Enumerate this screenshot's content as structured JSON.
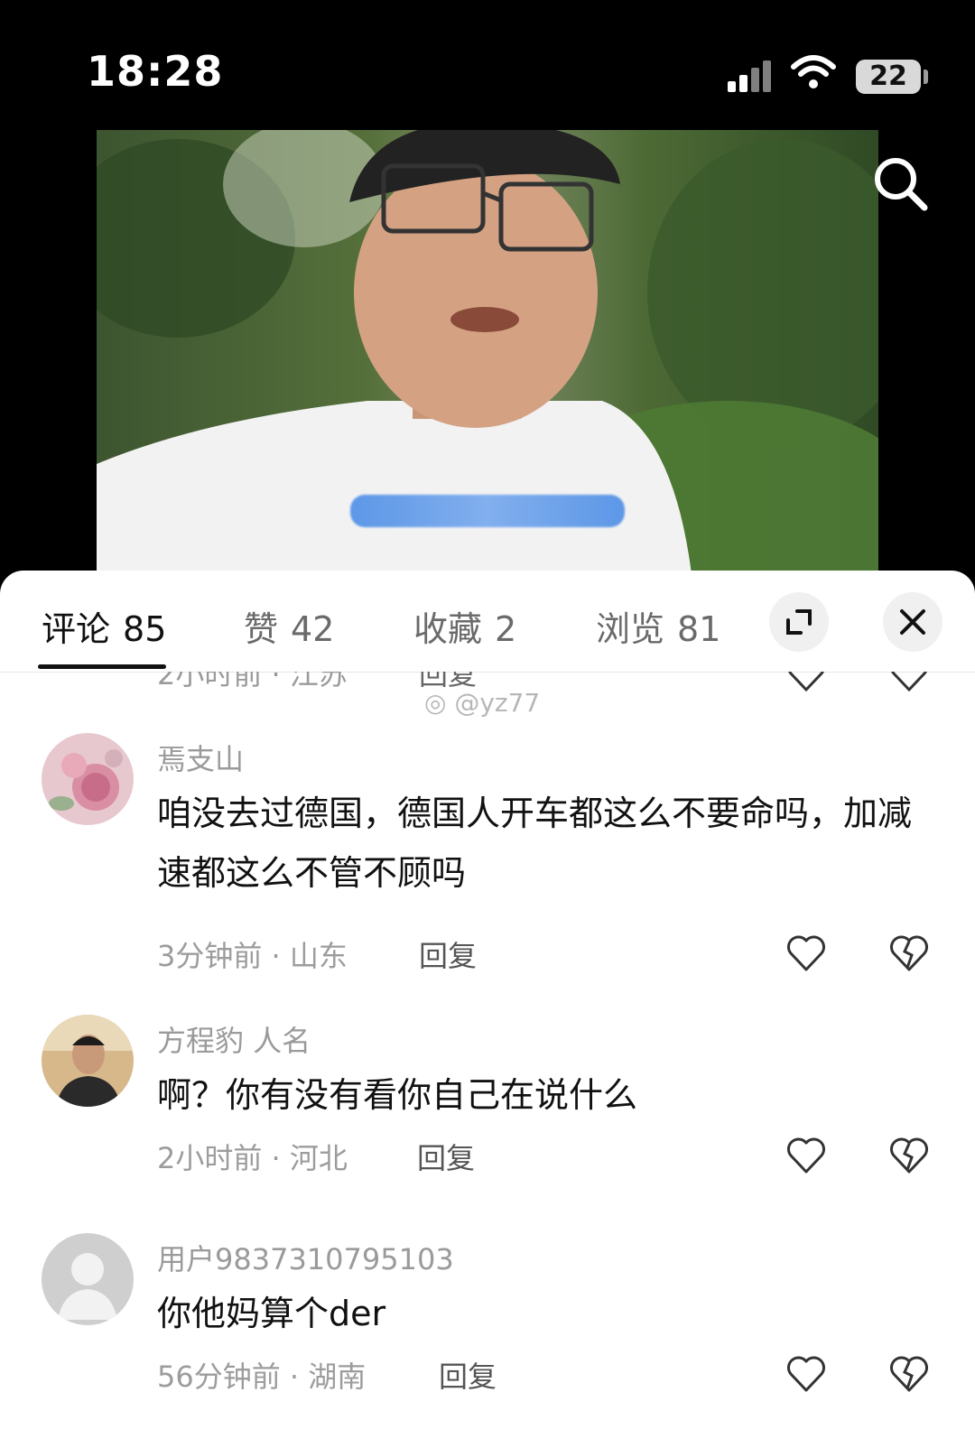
{
  "status_bar": {
    "time": "18:28",
    "battery": "22",
    "signal_icon": "cellular-signal-icon",
    "wifi_icon": "wifi-icon"
  },
  "video": {
    "search_icon": "search-icon"
  },
  "panel": {
    "tabs": [
      {
        "label": "评论",
        "count": "85"
      },
      {
        "label": "赞",
        "count": "42"
      },
      {
        "label": "收藏",
        "count": "2"
      },
      {
        "label": "浏览",
        "count": "81"
      }
    ],
    "expand_icon": "expand-icon",
    "close_icon": "close-icon"
  },
  "partial_comment": {
    "meta": "2小时前 · 江苏",
    "reply": "回复"
  },
  "watermark": "@yz77",
  "comments": [
    {
      "username": "焉支山",
      "text": "咱没去过德国，德国人开车都这么不要命吗，加减速都这么不管不顾吗",
      "meta": "3分钟前 · 山东",
      "reply": "回复"
    },
    {
      "username": "方程豹 人名",
      "text": "啊？你有没有看你自己在说什么",
      "meta": "2小时前 · 河北",
      "reply": "回复"
    },
    {
      "username": "用户9837310795103",
      "text": "你他妈算个der",
      "meta": "56分钟前 · 湖南",
      "reply": "回复"
    }
  ]
}
